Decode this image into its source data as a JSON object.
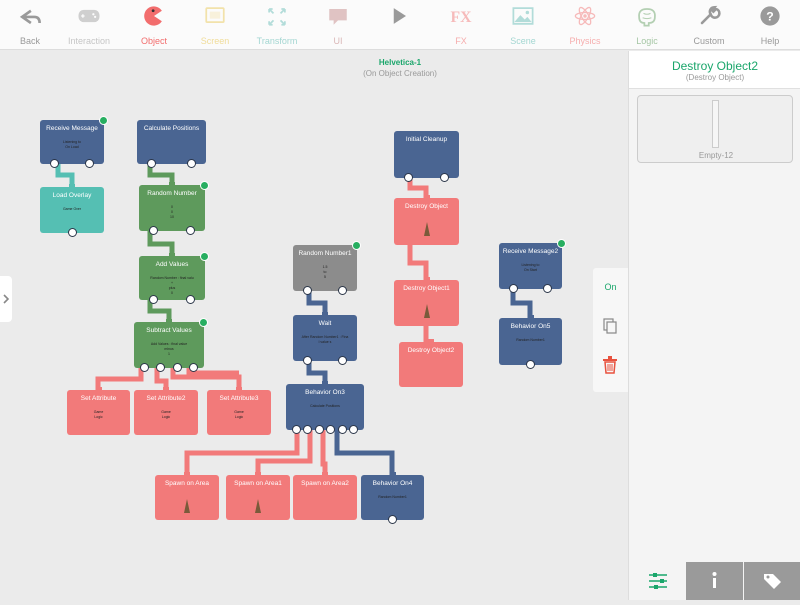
{
  "toolbar": {
    "items": [
      {
        "label": "Back",
        "icon": "back-arrow-icon",
        "active": false
      },
      {
        "label": "Interaction",
        "icon": "gamepad-icon",
        "active": false
      },
      {
        "label": "Object",
        "icon": "pacman-icon",
        "active": true
      },
      {
        "label": "Screen",
        "icon": "screen-icon",
        "active": false
      },
      {
        "label": "Transform",
        "icon": "expand-arrows-icon",
        "active": false
      },
      {
        "label": "UI",
        "icon": "speech-bubble-icon",
        "active": false
      },
      {
        "label": "",
        "icon": "play-icon",
        "active": false
      },
      {
        "label": "FX",
        "icon": "fx-icon",
        "active": false
      },
      {
        "label": "Scene",
        "icon": "scene-image-icon",
        "active": false
      },
      {
        "label": "Physics",
        "icon": "atom-icon",
        "active": false
      },
      {
        "label": "Logic",
        "icon": "brain-icon",
        "active": false
      },
      {
        "label": "Custom",
        "icon": "wrench-icon",
        "active": false
      },
      {
        "label": "Help",
        "icon": "help-icon",
        "active": false
      }
    ],
    "colors": {
      "active": "#f26d6d",
      "inactive": "#9a9a9a"
    }
  },
  "canvas": {
    "title": "Helvetica-1",
    "subtitle": "(On Object Creation)",
    "nodes": [
      {
        "id": "receive-message",
        "title": "Receive Message",
        "detail": "Listening to\nOn Load",
        "color": "blue",
        "badge": true
      },
      {
        "id": "load-overlay",
        "title": "Load Overlay",
        "detail": "Game Over",
        "color": "teal",
        "badge": false
      },
      {
        "id": "calculate-positions",
        "title": "Calculate Positions",
        "detail": "",
        "color": "blue",
        "badge": false
      },
      {
        "id": "random-number",
        "title": "Random Number",
        "detail": "0\n0\n10",
        "color": "green",
        "badge": true
      },
      {
        "id": "add-values",
        "title": "Add Values",
        "detail": "Random Number : final valu\n+\nplus\n0",
        "color": "green",
        "badge": true
      },
      {
        "id": "subtract-values",
        "title": "Subtract Values",
        "detail": "Add Values : final value\nminus\n1",
        "color": "green",
        "badge": true
      },
      {
        "id": "set-attribute",
        "title": "Set Attribute",
        "detail": "Game\nLogic",
        "color": "red",
        "badge": false
      },
      {
        "id": "set-attribute2",
        "title": "Set Attribute2",
        "detail": "Game\nLogic",
        "color": "red",
        "badge": false
      },
      {
        "id": "set-attribute3",
        "title": "Set Attribute3",
        "detail": "Game\nLogic",
        "color": "red",
        "badge": false
      },
      {
        "id": "random-number1",
        "title": "Random Number1",
        "detail": "1.5\nto\n5",
        "color": "grey",
        "badge": true
      },
      {
        "id": "wait",
        "title": "Wait",
        "detail": "After Random Number1 : Fina\nl value s",
        "color": "blue",
        "badge": false
      },
      {
        "id": "behavior-on3",
        "title": "Behavior On3",
        "detail": "Calculate Positions",
        "color": "blue",
        "badge": false
      },
      {
        "id": "spawn-on-area",
        "title": "Spawn on Area",
        "detail": "",
        "color": "red",
        "badge": false
      },
      {
        "id": "spawn-on-area1",
        "title": "Spawn on Area1",
        "detail": "",
        "color": "red",
        "badge": false
      },
      {
        "id": "spawn-on-area2",
        "title": "Spawn on Area2",
        "detail": "",
        "color": "red",
        "badge": false
      },
      {
        "id": "behavior-on4",
        "title": "Behavior On4",
        "detail": "Random Number1",
        "color": "blue",
        "badge": false
      },
      {
        "id": "initial-cleanup",
        "title": "Initial Cleanup",
        "detail": "",
        "color": "blue",
        "badge": false
      },
      {
        "id": "destroy-object",
        "title": "Destroy Object",
        "detail": "",
        "color": "red",
        "badge": false
      },
      {
        "id": "destroy-object1",
        "title": "Destroy Object1",
        "detail": "",
        "color": "red",
        "badge": false
      },
      {
        "id": "destroy-object2",
        "title": "Destroy Object2",
        "detail": "",
        "color": "red",
        "badge": false
      },
      {
        "id": "receive-message2",
        "title": "Receive Message2",
        "detail": "Listening to\nOn Start",
        "color": "blue",
        "badge": true
      },
      {
        "id": "behavior-on5",
        "title": "Behavior On5",
        "detail": "Random Number1",
        "color": "blue",
        "badge": false
      }
    ]
  },
  "float_actions": {
    "toggle_label": "On",
    "toggle_color": "#1aa66b",
    "delete_color": "#e8523f"
  },
  "panel": {
    "title": "Destroy Object2",
    "subtitle": "(Destroy Object)",
    "preview_label": "Empty-12",
    "tabs": [
      {
        "icon": "sliders-icon",
        "active": true
      },
      {
        "icon": "info-icon",
        "active": false
      },
      {
        "icon": "tags-icon",
        "active": false
      }
    ]
  }
}
